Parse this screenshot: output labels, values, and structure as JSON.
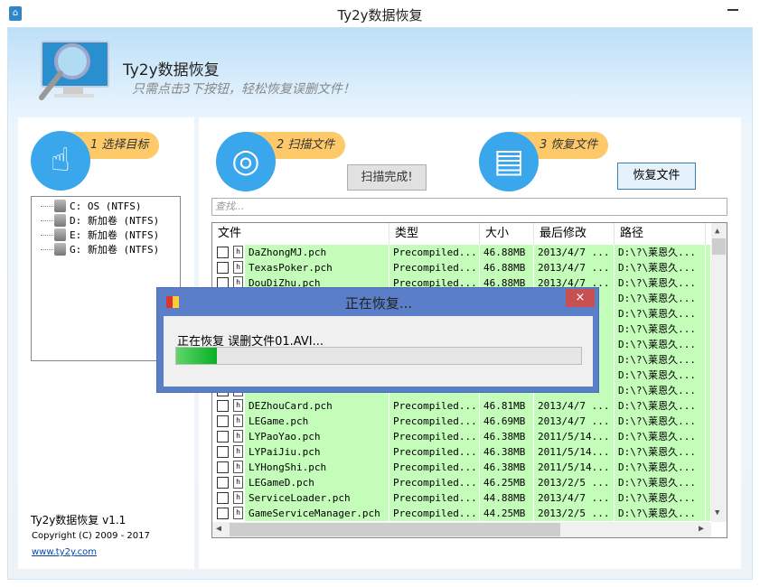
{
  "window": {
    "title": "Ty2y数据恢复",
    "icon": "app-icon"
  },
  "header": {
    "title": "Ty2y数据恢复",
    "slogan": "只需点击3下按钮，轻松恢复误删文件！"
  },
  "steps": [
    {
      "label": "1 选择目标",
      "icon": "hand-pointer-icon"
    },
    {
      "label": "2 扫描文件",
      "icon": "radar-icon"
    },
    {
      "label": "3 恢复文件",
      "icon": "document-search-icon"
    }
  ],
  "scan_button": "扫描完成!",
  "recover_button": "恢复文件",
  "drives": [
    "C: OS (NTFS)",
    "D: 新加卷 (NTFS)",
    "E: 新加卷 (NTFS)",
    "G: 新加卷 (NTFS)"
  ],
  "search": {
    "placeholder": "查找..."
  },
  "table": {
    "columns": [
      "文件",
      "类型",
      "大小",
      "最后修改",
      "路径"
    ],
    "rows": [
      {
        "file": "DaZhongMJ.pch",
        "type": "Precompiled...",
        "size": "46.88MB",
        "date": "2013/4/7 ...",
        "path": "D:\\?\\莱恩久..."
      },
      {
        "file": "TexasPoker.pch",
        "type": "Precompiled...",
        "size": "46.88MB",
        "date": "2013/4/7 ...",
        "path": "D:\\?\\莱恩久..."
      },
      {
        "file": "DouDiZhu.pch",
        "type": "Precompiled...",
        "size": "46.88MB",
        "date": "2013/4/7 ...",
        "path": "D:\\?\\莱恩久..."
      },
      {
        "file": "",
        "type": "",
        "size": "",
        "date": "",
        "path": "D:\\?\\莱恩久..."
      },
      {
        "file": "",
        "type": "",
        "size": "",
        "date": "",
        "path": "D:\\?\\莱恩久..."
      },
      {
        "file": "",
        "type": "",
        "size": "",
        "date": "",
        "path": "D:\\?\\莱恩久..."
      },
      {
        "file": "",
        "type": "",
        "size": "",
        "date": "",
        "path": "D:\\?\\莱恩久..."
      },
      {
        "file": "",
        "type": "",
        "size": "",
        "date": "",
        "path": "D:\\?\\莱恩久..."
      },
      {
        "file": "",
        "type": "",
        "size": "",
        "date": "",
        "path": "D:\\?\\莱恩久..."
      },
      {
        "file": "",
        "type": "",
        "size": "",
        "date": "",
        "path": "D:\\?\\莱恩久..."
      },
      {
        "file": "DEZhouCard.pch",
        "type": "Precompiled...",
        "size": "46.81MB",
        "date": "2013/4/7 ...",
        "path": "D:\\?\\莱恩久..."
      },
      {
        "file": "LEGame.pch",
        "type": "Precompiled...",
        "size": "46.69MB",
        "date": "2013/4/7 ...",
        "path": "D:\\?\\莱恩久..."
      },
      {
        "file": "LYPaoYao.pch",
        "type": "Precompiled...",
        "size": "46.38MB",
        "date": "2011/5/14...",
        "path": "D:\\?\\莱恩久..."
      },
      {
        "file": "LYPaiJiu.pch",
        "type": "Precompiled...",
        "size": "46.38MB",
        "date": "2011/5/14...",
        "path": "D:\\?\\莱恩久..."
      },
      {
        "file": "LYHongShi.pch",
        "type": "Precompiled...",
        "size": "46.38MB",
        "date": "2011/5/14...",
        "path": "D:\\?\\莱恩久..."
      },
      {
        "file": "LEGameD.pch",
        "type": "Precompiled...",
        "size": "46.25MB",
        "date": "2013/2/5 ...",
        "path": "D:\\?\\莱恩久..."
      },
      {
        "file": "ServiceLoader.pch",
        "type": "Precompiled...",
        "size": "44.88MB",
        "date": "2013/4/7 ...",
        "path": "D:\\?\\莱恩久..."
      },
      {
        "file": "GameServiceManager.pch",
        "type": "Precompiled...",
        "size": "44.25MB",
        "date": "2013/2/5 ...",
        "path": "D:\\?\\莱恩久..."
      }
    ]
  },
  "footer": {
    "version": "Ty2y数据恢复 v1.1",
    "copyright": "Copyright (C) 2009 - 2017",
    "link": "www.ty2y.com"
  },
  "dialog": {
    "title": "正在恢复...",
    "message": "正在恢复 误删文件01.AVI...",
    "progress_percent": 10,
    "close": "×"
  },
  "colors": {
    "row_bg": "#c4fdb9",
    "accent": "#3aa6ec",
    "pill": "#fdc969",
    "dialog_frame": "#5b7ec9"
  }
}
